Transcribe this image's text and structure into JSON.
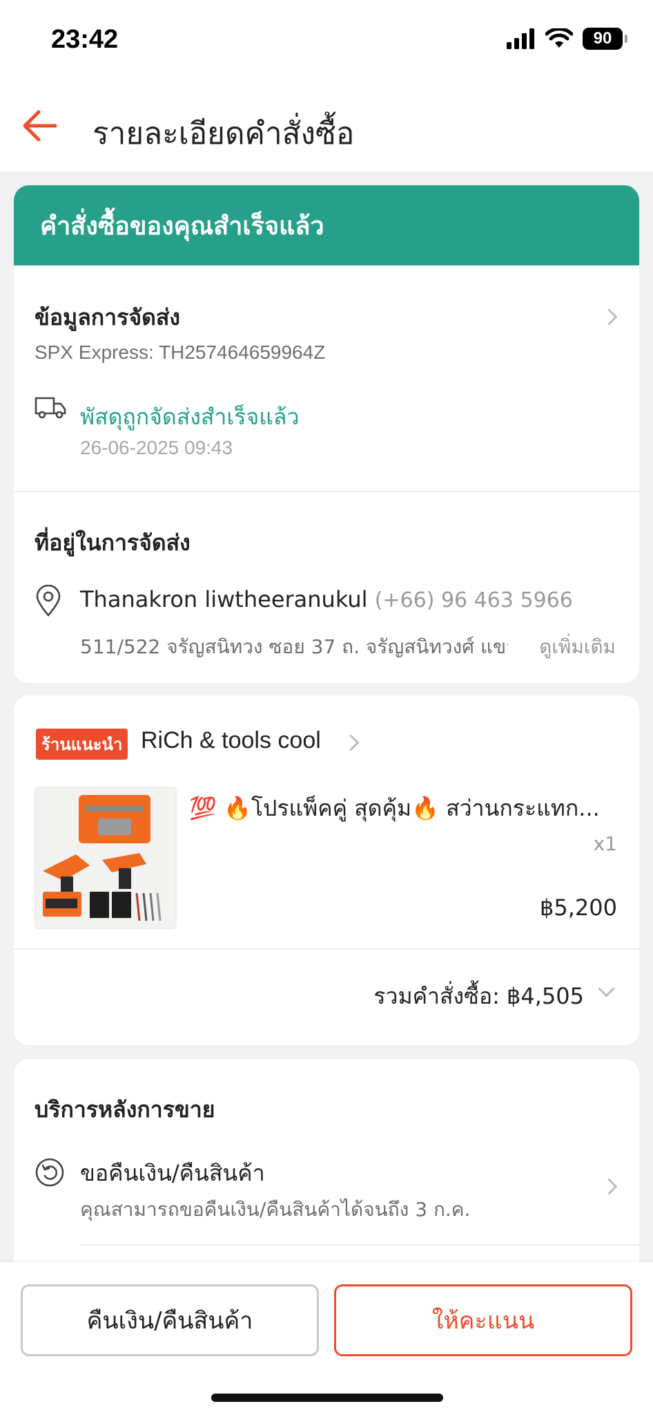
{
  "status_bar": {
    "time": "23:42",
    "battery": "90"
  },
  "header": {
    "title": "รายละเอียดคำสั่งซื้อ"
  },
  "order_status": {
    "banner": "คำสั่งซื้อของคุณสำเร็จแล้ว"
  },
  "shipping": {
    "title": "ข้อมูลการจัดส่ง",
    "carrier_tracking": "SPX Express: TH257464659964Z",
    "status": "พัสดุถูกจัดส่งสำเร็จแล้ว",
    "timestamp": "26-06-2025 09:43"
  },
  "address": {
    "title": "ที่อยู่ในการจัดส่ง",
    "name": "Thanakron liwtheeranukul",
    "phone": "(+66) 96 463 5966",
    "detail": "511/522 จรัญสนิทวง ซอย 37 ถ. จรัญสนิทวงศ์ แขวง...",
    "more_link": "ดูเพิ่มเติม"
  },
  "shop": {
    "badge": "ร้านแนะนำ",
    "name": "RiCh & tools cool"
  },
  "product": {
    "title": "💯 🔥โปรแพ็คคู่ สุดคุ้ม🔥 สว่านกระแทก...",
    "quantity": "x1",
    "price": "฿5,200"
  },
  "order_total": {
    "label": "รวมคำสั่งซื้อ: ฿4,505"
  },
  "after_sales": {
    "title": "บริการหลังการขาย",
    "refund_title": "ขอคืนเงิน/คืนสินค้า",
    "refund_desc": "คุณสามารถขอคืนเงิน/คืนสินค้าได้จนถึง 3 ก.ค."
  },
  "actions": {
    "refund_button": "คืนเงิน/คืนสินค้า",
    "rate_button": "ให้คะแนน"
  },
  "colors": {
    "accent": "#ee4d2d",
    "success": "#26a08a"
  }
}
